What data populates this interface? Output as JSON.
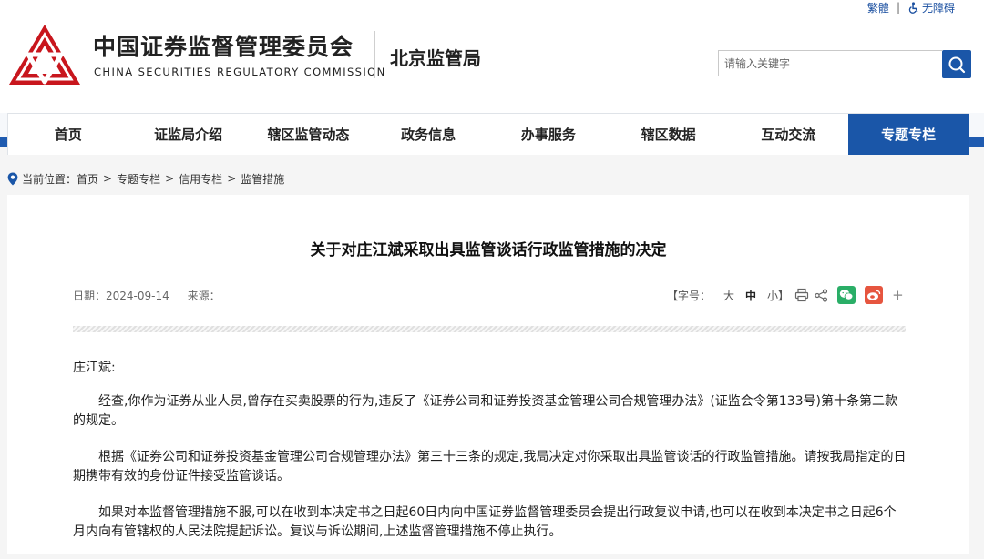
{
  "header": {
    "top_links": {
      "traditional": "繁體",
      "separator": "|",
      "accessibility": "无障碍"
    },
    "org_name_cn": "中国证券监督管理委员会",
    "org_name_en": "CHINA SECURITIES REGULATORY COMMISSION",
    "bureau": "北京监管局",
    "search": {
      "placeholder": "请输入关键字",
      "icon": "search-icon"
    }
  },
  "nav": {
    "items": [
      "首页",
      "证监局介绍",
      "辖区监管动态",
      "政务信息",
      "办事服务",
      "辖区数据",
      "互动交流",
      "专题专栏"
    ],
    "active_index": 7
  },
  "breadcrumb": {
    "label": "当前位置：",
    "items": [
      "首页",
      "专题专栏",
      "信用专栏",
      "监管措施"
    ],
    "separator": ">"
  },
  "article": {
    "title": "关于对庄江斌采取出具监管谈话行政监管措施的决定",
    "date_label": "日期：",
    "date": "2024-09-14",
    "source_label": "来源：",
    "font_size": {
      "label": "【字号：",
      "large": "大",
      "medium": "中",
      "small": "小】"
    },
    "more": "+",
    "salutation": "庄江斌:",
    "paragraphs": [
      "经查,你作为证券从业人员,曾存在买卖股票的行为,违反了《证券公司和证券投资基金管理公司合规管理办法》(证监会令第133号)第十条第二款的规定。",
      "根据《证券公司和证券投资基金管理公司合规管理办法》第三十三条的规定,我局决定对你采取出具监管谈话的行政监管措施。请按我局指定的日期携带有效的身份证件接受监管谈话。",
      "如果对本监督管理措施不服,可以在收到本决定书之日起60日内向中国证券监督管理委员会提出行政复议申请,也可以在收到本决定书之日起6个月内向有管辖权的人民法院提起诉讼。复议与诉讼期间,上述监督管理措施不停止执行。"
    ]
  },
  "colors": {
    "brand_red": "#c8161d",
    "nav_blue": "#1a56a8",
    "wechat_green": "#2aae67",
    "weibo_red": "#e6553f"
  }
}
